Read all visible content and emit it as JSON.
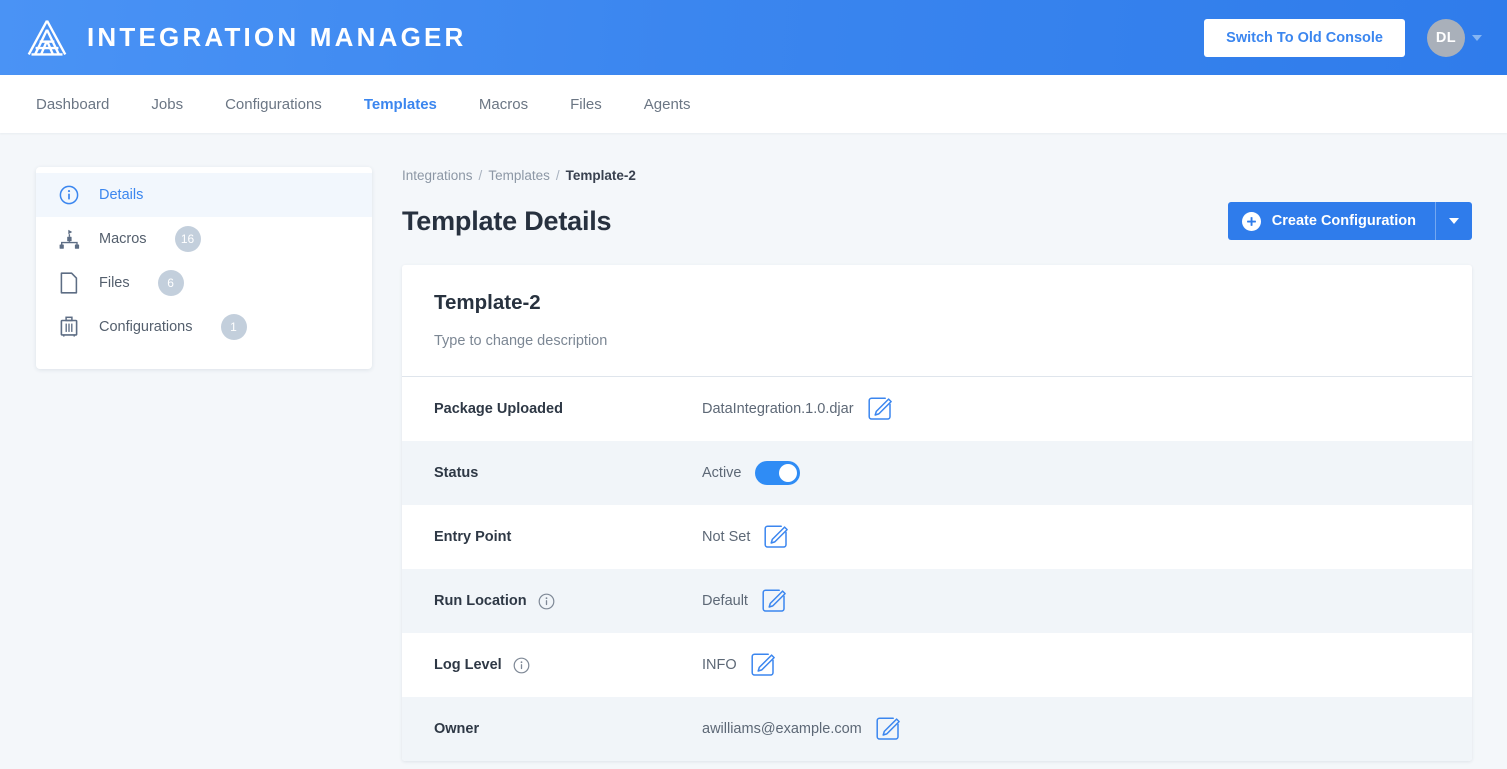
{
  "header": {
    "brand_title": "INTEGRATION MANAGER",
    "logo_icon": "mountain-logo-icon",
    "switch_console_label": "Switch To Old Console",
    "avatar_initials": "DL",
    "accent_blue": "#3b86ef",
    "header_bg": "#3b86ef"
  },
  "nav": {
    "items": [
      {
        "label": "Dashboard",
        "active": false
      },
      {
        "label": "Jobs",
        "active": false
      },
      {
        "label": "Configurations",
        "active": false
      },
      {
        "label": "Templates",
        "active": true
      },
      {
        "label": "Macros",
        "active": false
      },
      {
        "label": "Files",
        "active": false
      },
      {
        "label": "Agents",
        "active": false
      }
    ]
  },
  "sidebar": {
    "items": [
      {
        "label": "Details",
        "icon": "info-circle-icon",
        "badge": "",
        "active": true
      },
      {
        "label": "Macros",
        "icon": "hierarchy-icon",
        "badge": "16",
        "active": false
      },
      {
        "label": "Files",
        "icon": "document-icon",
        "badge": "6",
        "active": false
      },
      {
        "label": "Configurations",
        "icon": "briefcase-icon",
        "badge": "1",
        "active": false
      }
    ]
  },
  "breadcrumb": {
    "items": [
      "Integrations",
      "Templates",
      "Template-2"
    ],
    "separator": "/"
  },
  "page": {
    "title": "Template Details",
    "create_button_label": "Create Configuration",
    "create_button_icon": "plus-circle-icon",
    "split_button_icon": "chevron-down-icon"
  },
  "detail_card": {
    "name": "Template-2",
    "description_placeholder": "Type to change description",
    "rows": [
      {
        "label": "Package Uploaded",
        "value": "DataIntegration.1.0.djar",
        "has_info": false,
        "control": "edit"
      },
      {
        "label": "Status",
        "value": "Active",
        "has_info": false,
        "control": "toggle",
        "toggle_on": true
      },
      {
        "label": "Entry Point",
        "value": "Not Set",
        "has_info": false,
        "control": "edit"
      },
      {
        "label": "Run Location",
        "value": "Default",
        "has_info": true,
        "control": "edit"
      },
      {
        "label": "Log Level",
        "value": "INFO",
        "has_info": true,
        "control": "edit"
      },
      {
        "label": "Owner",
        "value": "awilliams@example.com",
        "has_info": false,
        "control": "edit"
      }
    ]
  }
}
